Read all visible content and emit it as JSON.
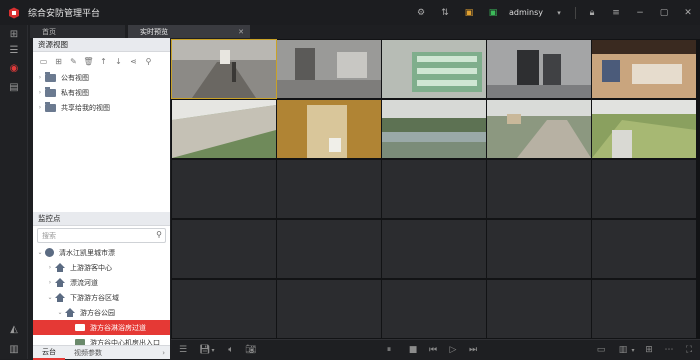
{
  "app": {
    "title": "综合安防管理平台",
    "user": "adminsy"
  },
  "tabs": [
    {
      "label": "首页"
    },
    {
      "label": "实时预览"
    }
  ],
  "resource_view": {
    "header": "资源视图",
    "items": [
      {
        "label": "公有视图"
      },
      {
        "label": "私有视图"
      },
      {
        "label": "共享给我的视图"
      }
    ]
  },
  "monitor": {
    "header": "监控点",
    "search_placeholder": "搜索",
    "tree": [
      {
        "label": "清水江凯里城市漂",
        "level": 0,
        "icon": "globe-icon",
        "expanded": true
      },
      {
        "label": "上游游客中心",
        "level": 1,
        "icon": "house-icon",
        "expanded": false
      },
      {
        "label": "漂流河道",
        "level": 1,
        "icon": "house-icon",
        "expanded": false
      },
      {
        "label": "下游游方谷区域",
        "level": 1,
        "icon": "house-icon",
        "expanded": true
      },
      {
        "label": "游方谷公园",
        "level": 2,
        "icon": "house-icon",
        "expanded": true
      },
      {
        "label": "游方谷淋浴房过道",
        "level": 3,
        "icon": "camera-icon",
        "selected": true
      },
      {
        "label": "游方谷中心机房出入口",
        "level": 3,
        "icon": "camera-icon"
      }
    ]
  },
  "bottom_tabs": [
    {
      "label": "云台"
    },
    {
      "label": "视频参数"
    }
  ],
  "colors": {
    "accent": "#e53935",
    "selection_border": "#c9a227"
  }
}
